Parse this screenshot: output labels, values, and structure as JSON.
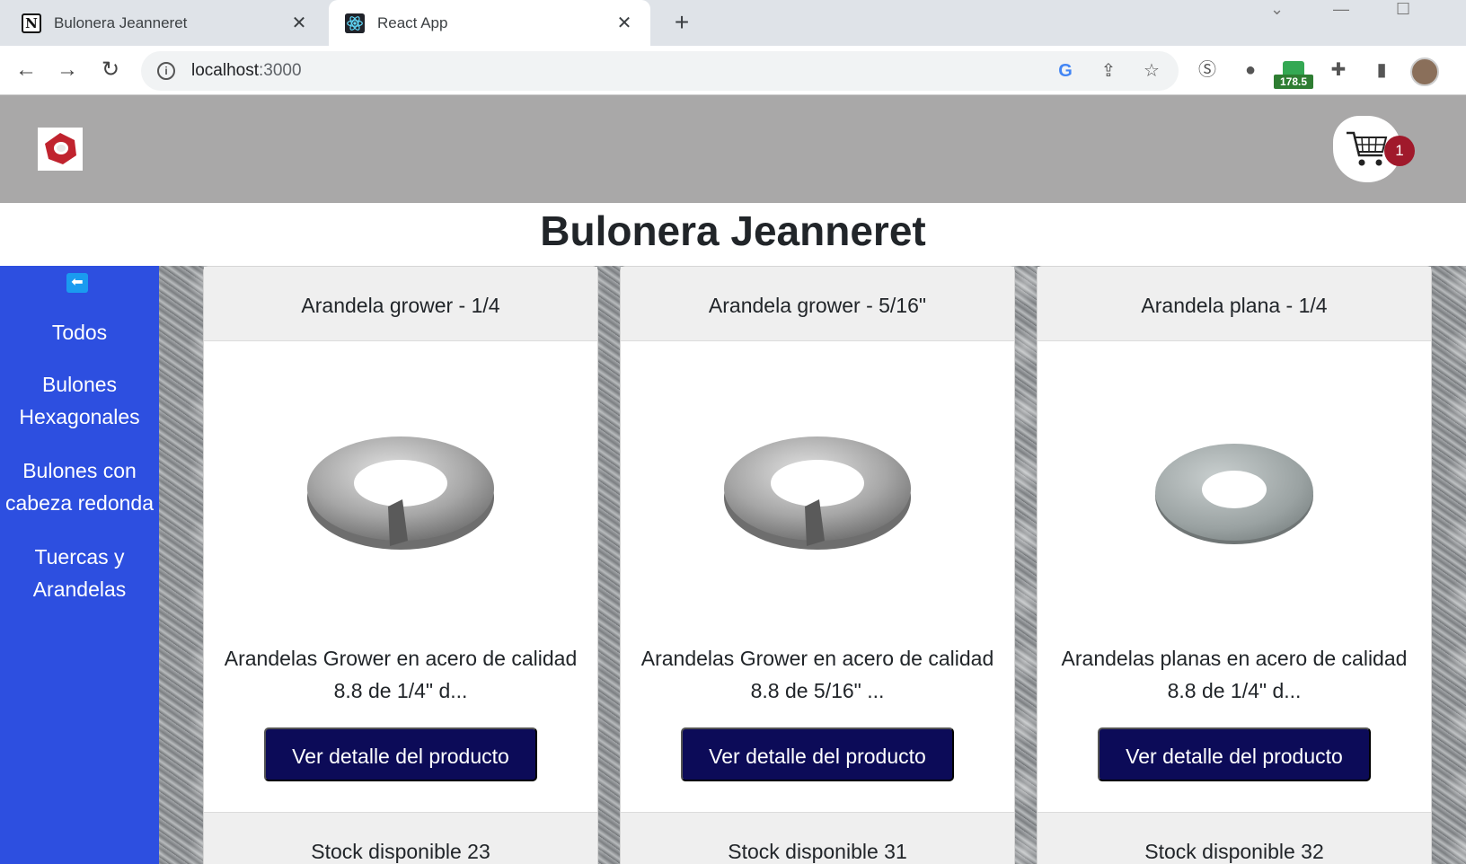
{
  "browser": {
    "tabs": [
      {
        "title": "Bulonera Jeanneret",
        "favicon": "notion-icon",
        "active": false
      },
      {
        "title": "React App",
        "favicon": "react-icon",
        "active": true
      }
    ],
    "url": {
      "host": "localhost",
      "port": ":3000"
    },
    "extension_badge": "178.5"
  },
  "header": {
    "logo": "nut-logo-icon",
    "cart_count": "1"
  },
  "store_title": "Bulonera Jeanneret",
  "sidebar": {
    "back_icon": "arrow-left-icon",
    "categories": [
      {
        "line1": "Todos",
        "line2": ""
      },
      {
        "line1": "Bulones",
        "line2": "Hexagonales"
      },
      {
        "line1": "Bulones con",
        "line2": "cabeza redonda"
      },
      {
        "line1": "Tuercas y",
        "line2": "Arandelas"
      }
    ]
  },
  "products": [
    {
      "title": "Arandela grower - 1/4",
      "desc_line1": "Arandelas Grower en acero de calidad",
      "desc_line2": "8.8 de 1/4\" d...",
      "button": "Ver detalle del producto",
      "stock": "Stock disponible 23",
      "image": "spring-washer"
    },
    {
      "title": "Arandela grower - 5/16\"",
      "desc_line1": "Arandelas Grower en acero de calidad",
      "desc_line2": "8.8 de 5/16\" ...",
      "button": "Ver detalle del producto",
      "stock": "Stock disponible 31",
      "image": "spring-washer"
    },
    {
      "title": "Arandela plana - 1/4",
      "desc_line1": "Arandelas planas en acero de calidad",
      "desc_line2": "8.8 de 1/4\" d...",
      "button": "Ver detalle del producto",
      "stock": "Stock disponible 32",
      "image": "flat-washer"
    }
  ],
  "colors": {
    "header_bg": "#a9a8a8",
    "sidebar_bg": "#2d4fe0",
    "button_bg": "#0c0b58",
    "cart_badge": "#a0192b"
  }
}
